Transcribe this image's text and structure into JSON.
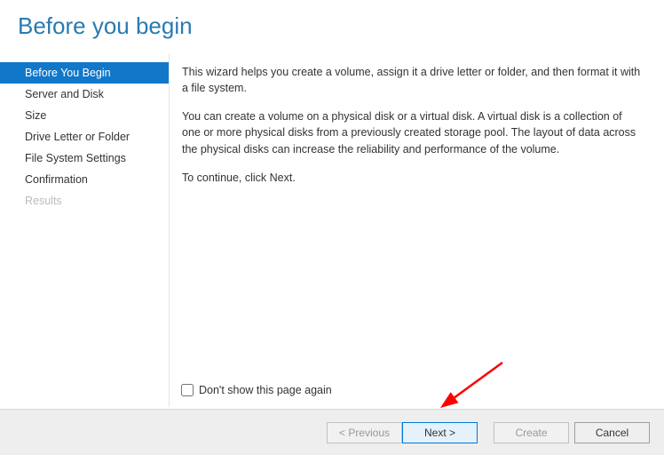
{
  "title": "Before you begin",
  "sidebar": {
    "items": [
      {
        "label": "Before You Begin",
        "state": "active"
      },
      {
        "label": "Server and Disk",
        "state": "normal"
      },
      {
        "label": "Size",
        "state": "normal"
      },
      {
        "label": "Drive Letter or Folder",
        "state": "normal"
      },
      {
        "label": "File System Settings",
        "state": "normal"
      },
      {
        "label": "Confirmation",
        "state": "normal"
      },
      {
        "label": "Results",
        "state": "disabled"
      }
    ]
  },
  "content": {
    "para1": "This wizard helps you create a volume, assign it a drive letter or folder, and then format it with a file system.",
    "para2": "You can create a volume on a physical disk or a virtual disk. A virtual disk is a collection of one or more physical disks from a previously created storage pool. The layout of data across the physical disks can increase the reliability and performance of the volume.",
    "para3": "To continue, click Next."
  },
  "checkbox": {
    "label": "Don't show this page again"
  },
  "buttons": {
    "previous": "< Previous",
    "next": "Next >",
    "create": "Create",
    "cancel": "Cancel"
  }
}
